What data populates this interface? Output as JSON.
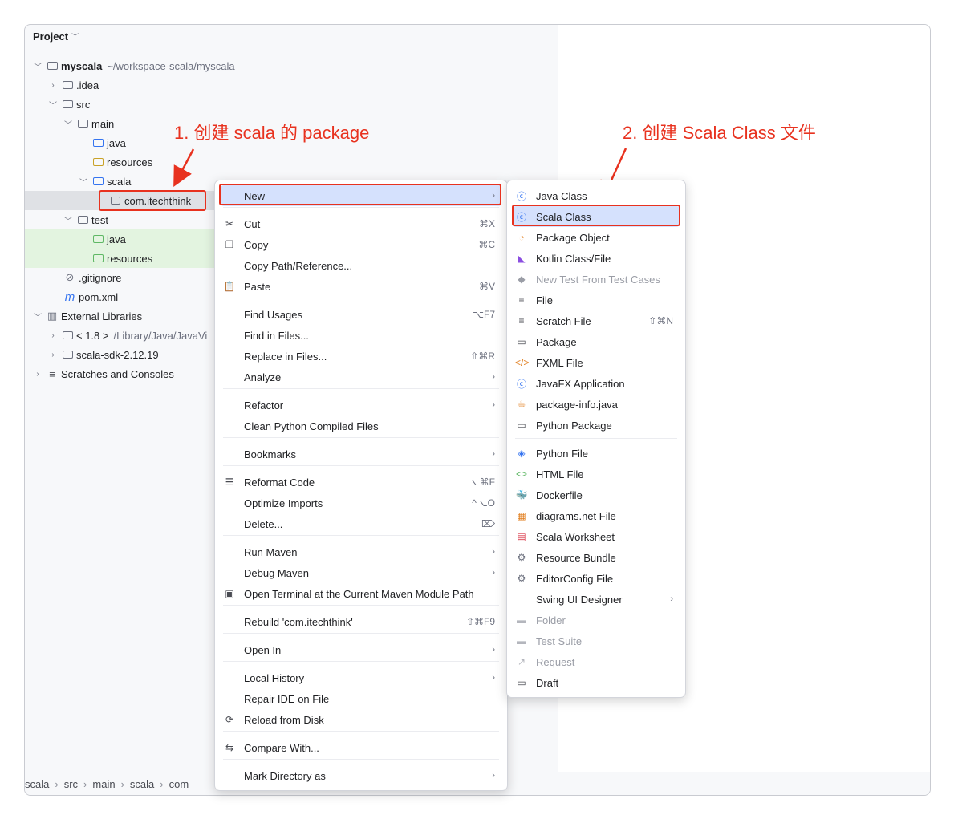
{
  "panel": {
    "title": "Project"
  },
  "tree": [
    {
      "label": "myscala",
      "sub": "~/workspace-scala/myscala"
    },
    {
      "label": ".idea"
    },
    {
      "label": "src"
    },
    {
      "label": "main"
    },
    {
      "label": "java"
    },
    {
      "label": "resources"
    },
    {
      "label": "scala"
    },
    {
      "label": "com.itechthink"
    },
    {
      "label": "test"
    },
    {
      "label": "java"
    },
    {
      "label": "resources"
    },
    {
      "label": ".gitignore"
    },
    {
      "label": "pom.xml"
    },
    {
      "label": "External Libraries"
    },
    {
      "label": "< 1.8 >",
      "sub": "/Library/Java/JavaVi"
    },
    {
      "label": "scala-sdk-2.12.19"
    },
    {
      "label": "Scratches and Consoles"
    }
  ],
  "breadcrumb": [
    "scala",
    "src",
    "main",
    "scala",
    "com"
  ],
  "annotations": {
    "step1": "1. 创建 scala 的 package",
    "step2": "2. 创建 Scala Class 文件"
  },
  "context_menu": [
    {
      "label": "New",
      "submenu": true
    },
    {
      "label": "Cut",
      "shortcut": "⌘X",
      "icon": "✂"
    },
    {
      "label": "Copy",
      "shortcut": "⌘C",
      "icon": "❐"
    },
    {
      "label": "Copy Path/Reference..."
    },
    {
      "label": "Paste",
      "shortcut": "⌘V",
      "icon": "📋"
    },
    {
      "label": "Find Usages",
      "shortcut": "⌥F7"
    },
    {
      "label": "Find in Files..."
    },
    {
      "label": "Replace in Files...",
      "shortcut": "⇧⌘R"
    },
    {
      "label": "Analyze",
      "submenu": true
    },
    {
      "label": "Refactor",
      "submenu": true
    },
    {
      "label": "Clean Python Compiled Files"
    },
    {
      "label": "Bookmarks",
      "submenu": true
    },
    {
      "label": "Reformat Code",
      "shortcut": "⌥⌘F",
      "icon": "☰"
    },
    {
      "label": "Optimize Imports",
      "shortcut": "^⌥O"
    },
    {
      "label": "Delete...",
      "shortcut": "⌦"
    },
    {
      "label": "Run Maven",
      "submenu": true
    },
    {
      "label": "Debug Maven",
      "submenu": true
    },
    {
      "label": "Open Terminal at the Current Maven Module Path",
      "icon": "▣"
    },
    {
      "label": "Rebuild 'com.itechthink'",
      "shortcut": "⇧⌘F9"
    },
    {
      "label": "Open In",
      "submenu": true
    },
    {
      "label": "Local History",
      "submenu": true
    },
    {
      "label": "Repair IDE on File"
    },
    {
      "label": "Reload from Disk",
      "icon": "⟳"
    },
    {
      "label": "Compare With...",
      "icon": "⇆"
    },
    {
      "label": "Mark Directory as",
      "submenu": true
    }
  ],
  "new_submenu": [
    {
      "label": "Java Class",
      "icon": "ⓒ",
      "color": "#3574f0"
    },
    {
      "label": "Scala Class",
      "icon": "ⓒ",
      "color": "#3574f0"
    },
    {
      "label": "Package Object",
      "icon": "◔",
      "color": "#e07b19"
    },
    {
      "label": "Kotlin Class/File",
      "icon": "◣",
      "color": "#8b4ee0"
    },
    {
      "label": "New Test From Test Cases",
      "icon": "◆",
      "color": "#9a9da6",
      "disabled": true
    },
    {
      "label": "File",
      "icon": "≡",
      "color": "#494b52"
    },
    {
      "label": "Scratch File",
      "shortcut": "⇧⌘N",
      "icon": "≡",
      "color": "#494b52"
    },
    {
      "label": "Package",
      "icon": "▭",
      "color": "#494b52"
    },
    {
      "label": "FXML File",
      "icon": "</>",
      "color": "#e07b19"
    },
    {
      "label": "JavaFX Application",
      "icon": "ⓒ",
      "color": "#3574f0"
    },
    {
      "label": "package-info.java",
      "icon": "☕",
      "color": "#e07b19"
    },
    {
      "label": "Python Package",
      "icon": "▭",
      "color": "#494b52"
    },
    {
      "label": "Python File",
      "icon": "◈",
      "color": "#3574f0"
    },
    {
      "label": "HTML File",
      "icon": "<>",
      "color": "#5fb865"
    },
    {
      "label": "Dockerfile",
      "icon": "🐳",
      "color": "#3574f0"
    },
    {
      "label": "diagrams.net File",
      "icon": "▦",
      "color": "#e07b19"
    },
    {
      "label": "Scala Worksheet",
      "icon": "▤",
      "color": "#db3b4b"
    },
    {
      "label": "Resource Bundle",
      "icon": "⚙",
      "color": "#6c707e"
    },
    {
      "label": "EditorConfig File",
      "icon": "⚙",
      "color": "#6c707e"
    },
    {
      "label": "Swing UI Designer",
      "submenu": true
    },
    {
      "label": "Folder",
      "icon": "▬",
      "color": "#b4b6bd",
      "disabled": true
    },
    {
      "label": "Test Suite",
      "icon": "▬",
      "color": "#b4b6bd",
      "disabled": true
    },
    {
      "label": "Request",
      "icon": "↗",
      "color": "#b4b6bd",
      "disabled": true
    },
    {
      "label": "Draft",
      "icon": "▭",
      "color": "#494b52"
    }
  ],
  "colors": {
    "accent_red": "#e8321f",
    "highlight": "#d5e1fd",
    "selection": "#dfe1e5",
    "test_green": "#e3f4e0"
  }
}
